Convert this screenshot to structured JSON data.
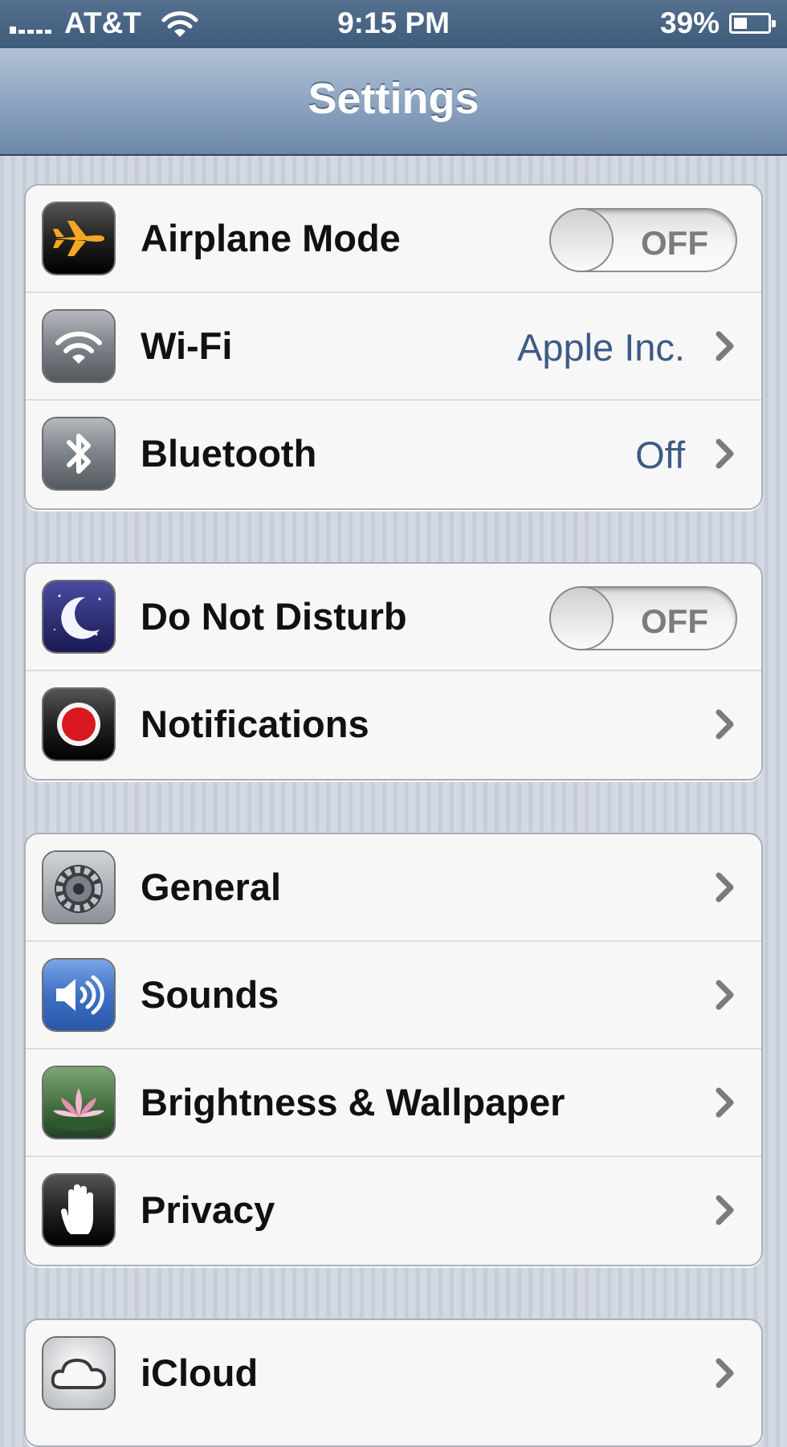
{
  "status_bar": {
    "carrier": "AT&T",
    "time": "9:15 PM",
    "battery": "39%",
    "battery_level": 0.39,
    "icons": [
      "signal-icon",
      "wifi-icon",
      "battery-icon"
    ]
  },
  "nav": {
    "title": "Settings"
  },
  "groups": [
    {
      "rows": [
        {
          "label": "Airplane Mode",
          "icon": "airplane-icon",
          "control": "toggle",
          "toggle_text": "OFF",
          "on": false
        },
        {
          "label": "Wi-Fi",
          "icon": "wifi-icon",
          "value": "Apple Inc.",
          "control": "chevron"
        },
        {
          "label": "Bluetooth",
          "icon": "bluetooth-icon",
          "value": "Off",
          "control": "chevron"
        }
      ]
    },
    {
      "rows": [
        {
          "label": "Do Not Disturb",
          "icon": "moon-icon",
          "control": "toggle",
          "toggle_text": "OFF",
          "on": false
        },
        {
          "label": "Notifications",
          "icon": "notifications-icon",
          "control": "chevron"
        }
      ]
    },
    {
      "rows": [
        {
          "label": "General",
          "icon": "gear-icon",
          "control": "chevron"
        },
        {
          "label": "Sounds",
          "icon": "speaker-icon",
          "control": "chevron"
        },
        {
          "label": "Brightness & Wallpaper",
          "icon": "flower-icon",
          "control": "chevron"
        },
        {
          "label": "Privacy",
          "icon": "hand-icon",
          "control": "chevron"
        }
      ]
    },
    {
      "rows": [
        {
          "label": "iCloud",
          "icon": "cloud-icon",
          "control": "chevron"
        }
      ]
    }
  ],
  "colors": {
    "value_text": "#3e5a85",
    "nav_bar": "#8ea5c0",
    "status_bar": "#3f5a7a",
    "notifications_red": "#d8181e"
  }
}
